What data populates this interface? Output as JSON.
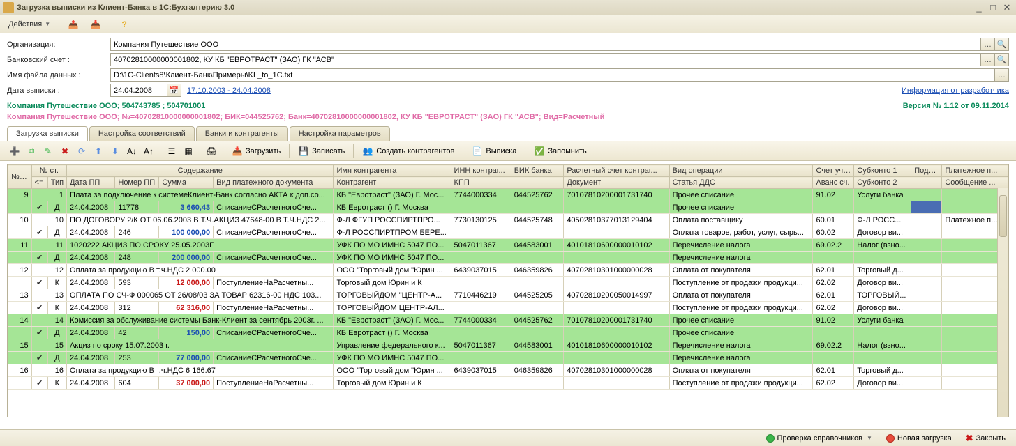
{
  "window": {
    "title": "Загрузка выписки из Клиент-Банка в 1С:Бухгалтерию 3.0"
  },
  "actionbar": {
    "actions": "Действия"
  },
  "form": {
    "org_label": "Организация:",
    "org_value": "Компания Путешествие ООО",
    "acc_label": "Банковский счет :",
    "acc_value": "40702810000000001802, КУ КБ \"ЕВРОТРАСТ\" (ЗАО) ГК \"АСВ\"",
    "file_label": "Имя файла данных :",
    "file_value": "D:\\1C-Clients8\\Клиент-Банк\\Примеры\\KL_to_1C.txt",
    "date_label": "Дата выписки :",
    "date_value": "24.04.2008",
    "period": "17.10.2003 - 24.04.2008",
    "devinfo": "Информация от разработчика",
    "version": "Версия № 1.12 от 09.11.2014",
    "info1": "Компания Путешествие ООО; 504743785 ; 504701001",
    "info2": "Компания Путешествие ООО; №=40702810000000001802; БИК=044525762; Банк=40702810000000001802, КУ КБ \"ЕВРОТРАСТ\" (ЗАО) ГК \"АСВ\"; Вид=Расчетный"
  },
  "tabs": [
    "Загрузка выписки",
    "Настройка соответствий",
    "Банки и контрагенты",
    "Настройка параметров"
  ],
  "toolbar": {
    "load": "Загрузить",
    "save": "Записать",
    "create": "Создать контрагентов",
    "stmt": "Выписка",
    "remember": "Запомнить"
  },
  "headers": {
    "r1": [
      "№ п/п",
      "№ ст.",
      "Содержание",
      "Имя контрагента",
      "ИНН контраг...",
      "БИК банка",
      "Расчетный счет контраг...",
      "Вид операции",
      "Счет уче...",
      "Субконто 1",
      "Подр...",
      "Платежное п..."
    ],
    "r2": [
      "<=",
      "Тип",
      "Дата ПП",
      "Номер ПП",
      "Сумма",
      "Вид платежного документа",
      "Контрагент",
      "КПП",
      "",
      "Документ",
      "Статья ДДС",
      "Аванс сч.",
      "Субконто 2",
      "",
      "Сообщение ..."
    ]
  },
  "rows": [
    {
      "g": 1,
      "n": "9",
      "st": "1",
      "desc": "Плата за подключение к системеКлиент-Банк согласно АКТА к доп.со...",
      "ctr": "КБ \"Евротраст\" (ЗАО) Г. Мос...",
      "inn": "7744000334",
      "bik": "044525762",
      "acc": "70107810200001731740",
      "op": "Прочее списание",
      "sch": "91.02",
      "sub": "Услуги банка"
    },
    {
      "g": 1,
      "tp": "Д",
      "chk": "✔",
      "dt": "24.04.2008",
      "pp": "11778",
      "amt": "3 660,43",
      "amtc": "blue",
      "doc": "СписаниеСРасчетногоСче...",
      "ctr": "КБ Евротраст () Г. Москва",
      "op": "Прочее списание",
      "sel": 1
    },
    {
      "n": "10",
      "st": "10",
      "desc": "ПО ДОГОВОРУ 2/К ОТ 06.06.2003 В Т.Ч.АКЦИЗ 47648-00 В Т.Ч.НДС 2...",
      "ctr": "Ф-Л ФГУП РОССПИРТПРО...",
      "inn": "7730130125",
      "bik": "044525748",
      "acc": "40502810377013129404",
      "op": "Оплата поставщику",
      "sch": "60.01",
      "sub": "Ф-Л РОСС...",
      "msg": "Платежное п..."
    },
    {
      "tp": "Д",
      "chk": "✔",
      "dt": "24.04.2008",
      "pp": "246",
      "amt": "100 000,00",
      "amtc": "blue",
      "doc": "СписаниеСРасчетногоСче...",
      "ctr": "Ф-Л РОССПИРТПРОМ БЕРЕ...",
      "op": "Оплата товаров, работ, услуг, сырь...",
      "sch": "60.02",
      "sub": "Договор ви..."
    },
    {
      "g": 1,
      "n": "11",
      "st": "11",
      "desc": "1020222 АКЦИЗ ПО СРОКУ 25.05.2003Г",
      "ctr": "УФК ПО МО ИМНС 5047 ПО...",
      "inn": "5047011367",
      "bik": "044583001",
      "acc": "40101810600000010102",
      "op": "Перечисление налога",
      "sch": "69.02.2",
      "sub": "Налог (взно..."
    },
    {
      "g": 1,
      "tp": "Д",
      "chk": "✔",
      "dt": "24.04.2008",
      "pp": "248",
      "amt": "200 000,00",
      "amtc": "blue",
      "doc": "СписаниеСРасчетногоСче...",
      "ctr": "УФК ПО МО ИМНС 5047 ПО...",
      "op": "Перечисление налога"
    },
    {
      "n": "12",
      "st": "12",
      "desc": "Оплата за продукцию    В т.ч.НДС 2 000.00",
      "ctr": "ООО \"Торговый дом \"Юрин ...",
      "inn": "6439037015",
      "bik": "046359826",
      "acc": "40702810301000000028",
      "op": "Оплата от покупателя",
      "sch": "62.01",
      "sub": "Торговый д..."
    },
    {
      "tp": "К",
      "chk": "✔",
      "dt": "24.04.2008",
      "pp": "593",
      "amt": "12 000,00",
      "amtc": "red",
      "doc": "ПоступлениеНаРасчетны...",
      "ctr": "Торговый дом Юрин и К",
      "op": "Поступление от продажи продукци...",
      "sch": "62.02",
      "sub": "Договор ви..."
    },
    {
      "n": "13",
      "st": "13",
      "desc": "ОПЛАТА ПО СЧ-Ф 000065 ОТ 26/08/03 ЗА ТОВАР  62316-00 НДС 103...",
      "ctr": "ТОРГОВЫЙДОМ \"ЦЕНТР-А...",
      "inn": "7710446219",
      "bik": "044525205",
      "acc": "40702810200050014997",
      "op": "Оплата от покупателя",
      "sch": "62.01",
      "sub": "ТОРГОВЫЙ..."
    },
    {
      "tp": "К",
      "chk": "✔",
      "dt": "24.04.2008",
      "pp": "312",
      "amt": "62 316,00",
      "amtc": "red",
      "doc": "ПоступлениеНаРасчетны...",
      "ctr": "ТОРГОВЫЙДОМ ЦЕНТР-АЛ...",
      "op": "Поступление от продажи продукци...",
      "sch": "62.02",
      "sub": "Договор ви..."
    },
    {
      "g": 1,
      "n": "14",
      "st": "14",
      "desc": "Комиссия за обслуживание системы Банк-Клиент за сентябрь 2003г. ...",
      "ctr": "КБ \"Евротраст\" (ЗАО) Г. Мос...",
      "inn": "7744000334",
      "bik": "044525762",
      "acc": "70107810200001731740",
      "op": "Прочее списание",
      "sch": "91.02",
      "sub": "Услуги банка"
    },
    {
      "g": 1,
      "tp": "Д",
      "chk": "✔",
      "dt": "24.04.2008",
      "pp": "42",
      "amt": "150,00",
      "amtc": "blue",
      "doc": "СписаниеСРасчетногоСче...",
      "ctr": "КБ Евротраст () Г. Москва",
      "op": "Прочее списание"
    },
    {
      "g": 1,
      "n": "15",
      "st": "15",
      "desc": "Акциз по сроку 15.07.2003 г.",
      "ctr": "Управление федерального к...",
      "inn": "5047011367",
      "bik": "044583001",
      "acc": "40101810600000010102",
      "op": "Перечисление налога",
      "sch": "69.02.2",
      "sub": "Налог (взно..."
    },
    {
      "g": 1,
      "tp": "Д",
      "chk": "✔",
      "dt": "24.04.2008",
      "pp": "253",
      "amt": "77 000,00",
      "amtc": "blue",
      "doc": "СписаниеСРасчетногоСче...",
      "ctr": "УФК ПО МО ИМНС 5047 ПО...",
      "op": "Перечисление налога"
    },
    {
      "n": "16",
      "st": "16",
      "desc": "Оплата за продукцию    В т.ч.НДС 6 166.67",
      "ctr": "ООО \"Торговый дом \"Юрин ...",
      "inn": "6439037015",
      "bik": "046359826",
      "acc": "40702810301000000028",
      "op": "Оплата от покупателя",
      "sch": "62.01",
      "sub": "Торговый д..."
    },
    {
      "tp": "К",
      "chk": "✔",
      "dt": "24.04.2008",
      "pp": "604",
      "amt": "37 000,00",
      "amtc": "red",
      "doc": "ПоступлениеНаРасчетны...",
      "ctr": "Торговый дом Юрин и К",
      "op": "Поступление от продажи продукци...",
      "sch": "62.02",
      "sub": "Договор ви..."
    }
  ],
  "status": {
    "chk": "Проверка справочников",
    "new": "Новая загрузка",
    "close": "Закрыть"
  }
}
